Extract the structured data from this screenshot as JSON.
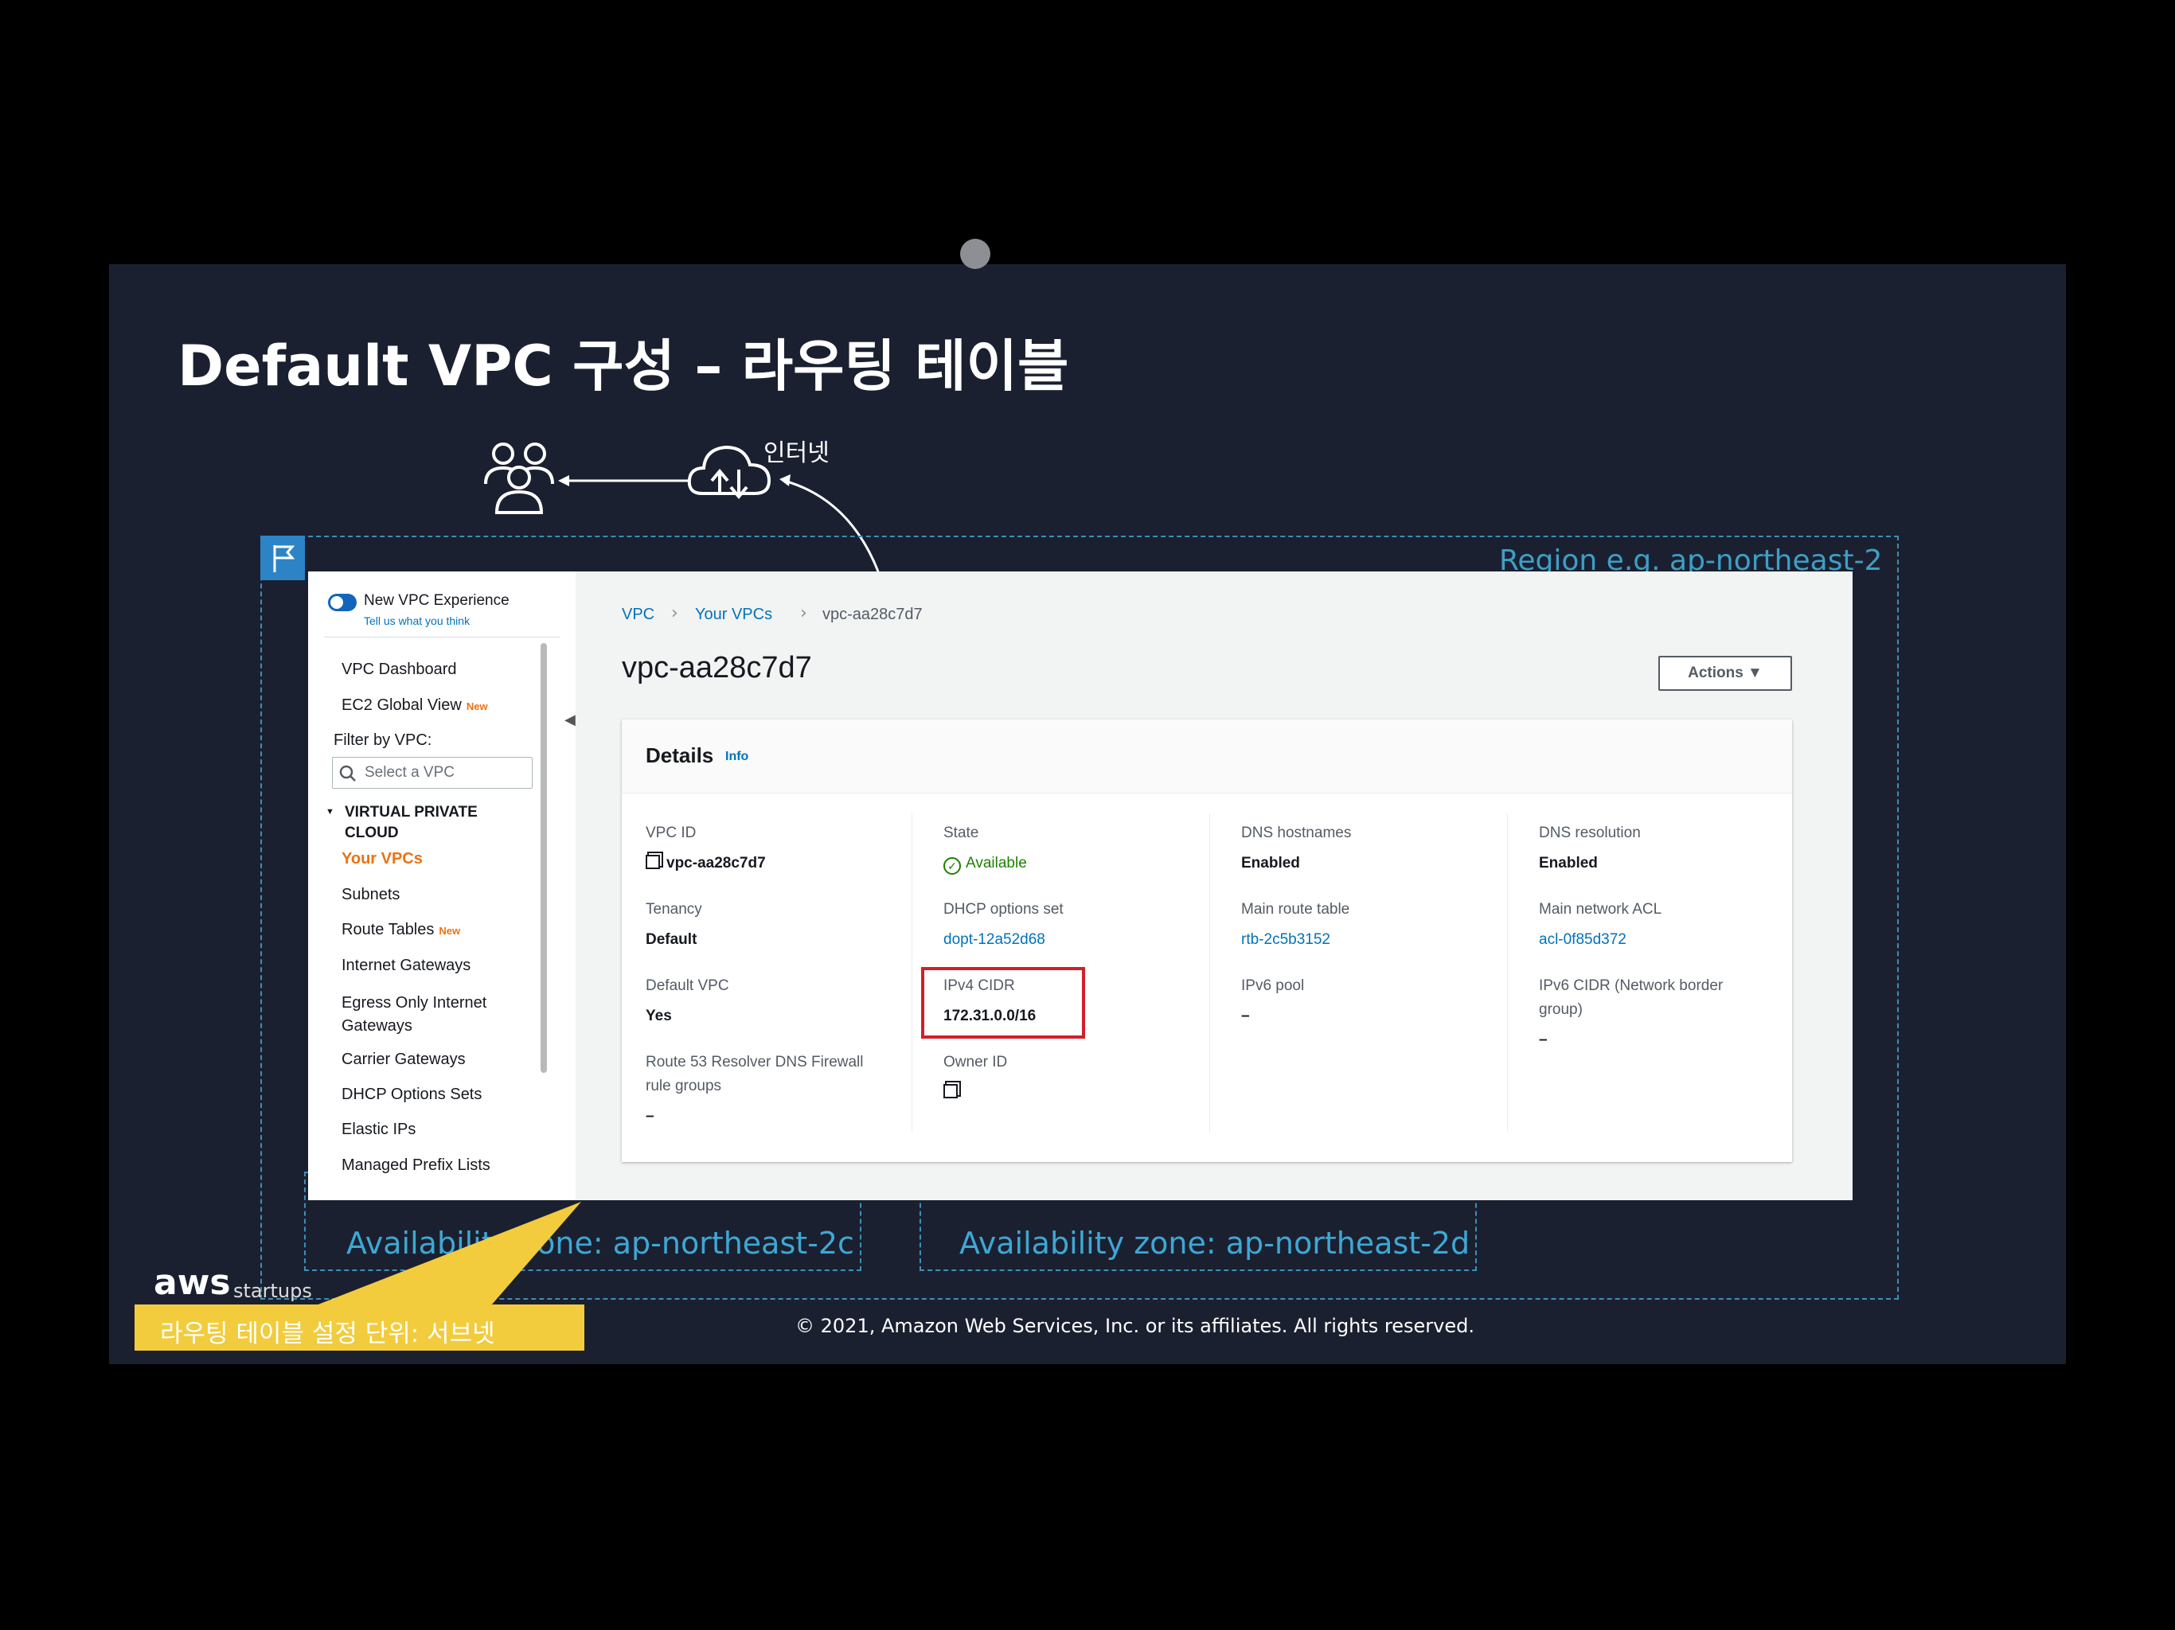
{
  "slide": {
    "title": "Default VPC 구성 – 라우팅 테이블",
    "internet_label": "인터넷",
    "region_label": "Region  e.g. ap-northeast-2",
    "az1_label": "Availability zone: ap-northeast-2c",
    "az2_label": "Availability zone: ap-northeast-2d",
    "aws_logo": "aws",
    "aws_sub": "startups",
    "callout": "라우팅 테이블 설정 단위: 서브넷",
    "copyright": "© 2021, Amazon Web Services, Inc. or its affiliates. All rights reserved."
  },
  "sidebar": {
    "experience_label": "New VPC Experience",
    "experience_sub": "Tell us what you think",
    "items_top": [
      "VPC Dashboard",
      "EC2 Global View"
    ],
    "new_badge": "New",
    "filter_label": "Filter by VPC:",
    "search_placeholder": "Select a VPC",
    "section_title": "VIRTUAL PRIVATE CLOUD",
    "items": [
      "Your VPCs",
      "Subnets",
      "Route Tables",
      "Internet Gateways",
      "Egress Only Internet Gateways",
      "Carrier Gateways",
      "DHCP Options Sets",
      "Elastic IPs",
      "Managed Prefix Lists"
    ]
  },
  "breadcrumb": [
    "VPC",
    "Your VPCs",
    "vpc-aa28c7d7"
  ],
  "page_title": "vpc-aa28c7d7",
  "actions_label": "Actions ▼",
  "details": {
    "title": "Details",
    "info": "Info",
    "fields": {
      "vpc_id": {
        "label": "VPC ID",
        "value": "vpc-aa28c7d7"
      },
      "state": {
        "label": "State",
        "value": "Available"
      },
      "dns_hostnames": {
        "label": "DNS hostnames",
        "value": "Enabled"
      },
      "dns_resolution": {
        "label": "DNS resolution",
        "value": "Enabled"
      },
      "tenancy": {
        "label": "Tenancy",
        "value": "Default"
      },
      "dhcp": {
        "label": "DHCP options set",
        "value": "dopt-12a52d68"
      },
      "main_route_table": {
        "label": "Main route table",
        "value": "rtb-2c5b3152"
      },
      "main_acl": {
        "label": "Main network ACL",
        "value": "acl-0f85d372"
      },
      "default_vpc": {
        "label": "Default VPC",
        "value": "Yes"
      },
      "ipv4_cidr": {
        "label": "IPv4 CIDR",
        "value": "172.31.0.0/16"
      },
      "ipv6_pool": {
        "label": "IPv6 pool",
        "value": "–"
      },
      "ipv6_cidr": {
        "label": "IPv6 CIDR (Network border group)",
        "value": "–"
      },
      "route53": {
        "label": "Route 53 Resolver DNS Firewall rule groups",
        "value": "–"
      },
      "owner_id": {
        "label": "Owner ID",
        "value": ""
      }
    }
  }
}
